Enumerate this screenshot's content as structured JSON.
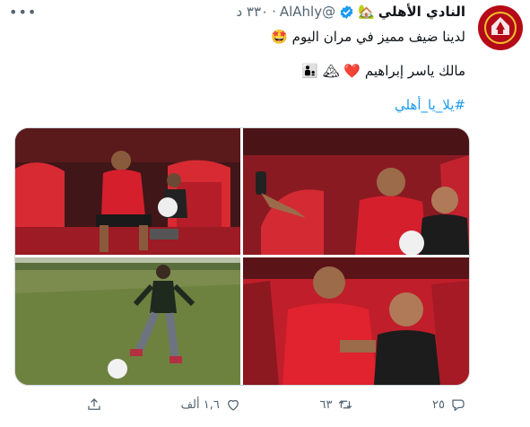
{
  "author": {
    "display_name": "النادي الأهلي",
    "name_emoji": "🏡",
    "username": "@AlAhly",
    "timestamp": "٣٣٠ د",
    "dot": "·"
  },
  "tweet": {
    "line1": "لدينا ضيف مميز في مران اليوم 🤩",
    "line2": "مالك ياسر إبراهيم ❤️ 🏔 👨‍👦",
    "hashtag": "#يلا_يا_أهلي"
  },
  "actions": {
    "reply_count": "٢٥",
    "retweet_count": "٦٣",
    "like_count": "١,٦ ألف"
  },
  "colors": {
    "accent": "#1d9bf0",
    "club_red": "#b50a17",
    "verified": "#1d9bf0"
  },
  "icons": [
    "ahly-logo-icon",
    "verified-badge-icon",
    "more-icon",
    "reply-icon",
    "retweet-icon",
    "like-icon",
    "share-icon"
  ]
}
